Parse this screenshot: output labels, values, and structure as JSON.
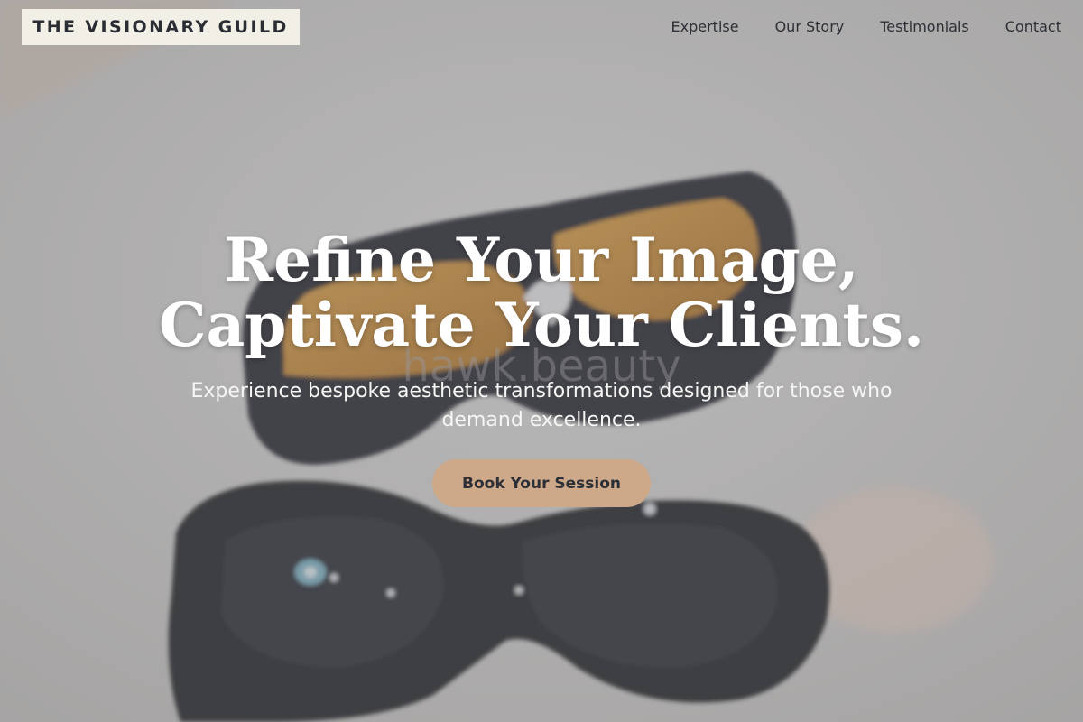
{
  "brand": {
    "name": "THE VISIONARY GUILD"
  },
  "nav": {
    "items": [
      {
        "label": "Expertise"
      },
      {
        "label": "Our Story"
      },
      {
        "label": "Testimonials"
      },
      {
        "label": "Contact"
      }
    ]
  },
  "hero": {
    "headline_line1": "Refine Your Image,",
    "headline_line2": "Captivate Your Clients.",
    "subheading": "Experience bespoke aesthetic transformations designed for those who demand excellence.",
    "cta_label": "Book Your Session",
    "background_watermark": "hawk.beauty",
    "background_image": "two pairs of dark laser safety glasses, one with amber lenses, on a white surface"
  },
  "colors": {
    "logo_bg": "#f1efe6",
    "text_dark": "#2c2f36",
    "cta_bg": "#cda98a",
    "headline": "#ffffff"
  }
}
